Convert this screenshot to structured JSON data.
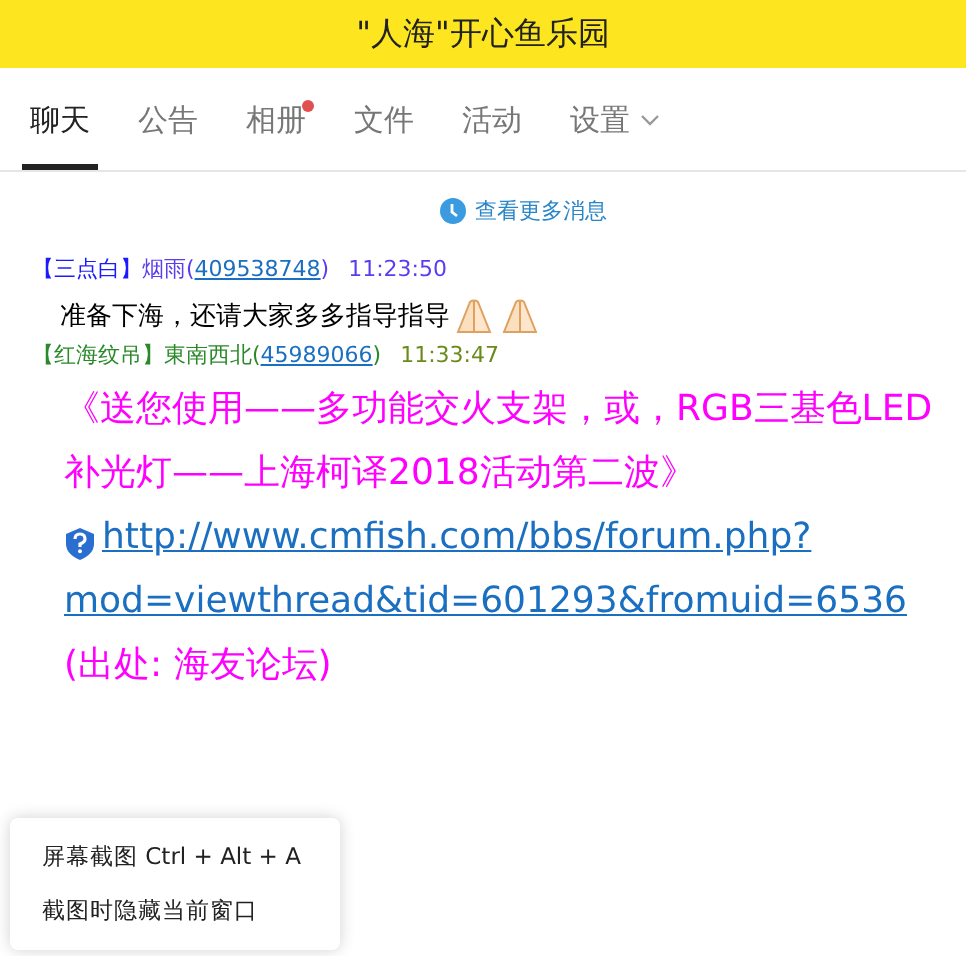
{
  "title": "\"人海\"开心鱼乐园",
  "tabs": [
    {
      "label": "聊天",
      "selected": true,
      "dot": false,
      "kind": "plain"
    },
    {
      "label": "公告",
      "selected": false,
      "dot": false,
      "kind": "plain"
    },
    {
      "label": "相册",
      "selected": false,
      "dot": true,
      "kind": "plain"
    },
    {
      "label": "文件",
      "selected": false,
      "dot": false,
      "kind": "plain"
    },
    {
      "label": "活动",
      "selected": false,
      "dot": false,
      "kind": "plain"
    },
    {
      "label": "设置",
      "selected": false,
      "dot": false,
      "kind": "dropdown"
    }
  ],
  "more_messages": "查看更多消息",
  "messages": [
    {
      "kind": "chat",
      "tag": "【三点白】",
      "name": "烟雨",
      "id_open": "(",
      "id": "409538748",
      "id_close": ")",
      "time": "11:23:50",
      "color": "#1a1aff",
      "body": [
        {
          "kind": "text",
          "text": "准备下海，还请大家多多指导指导"
        },
        {
          "kind": "emoji"
        },
        {
          "kind": "emoji"
        }
      ]
    },
    {
      "kind": "post",
      "tag": "【红海纹吊】",
      "name": "東南西北",
      "id_open": "(",
      "id": "45989066",
      "id_close": ")",
      "time": "11:33:47",
      "color": "#2a8a2a",
      "body": [
        {
          "kind": "text",
          "text": "《送您使用——多功能交火支架，或，RGB三基色LED补光灯——上海柯译2018活动第二波》"
        },
        {
          "kind": "link",
          "text": "http://www.cmfish.com/bbs/forum.php?mod=viewthread&tid=601293&fromuid=6536"
        },
        {
          "kind": "text",
          "text": "(出处: 海友论坛)"
        }
      ]
    }
  ],
  "context_menu": [
    "屏幕截图 Ctrl + Alt + A",
    "截图时隐藏当前窗口"
  ]
}
